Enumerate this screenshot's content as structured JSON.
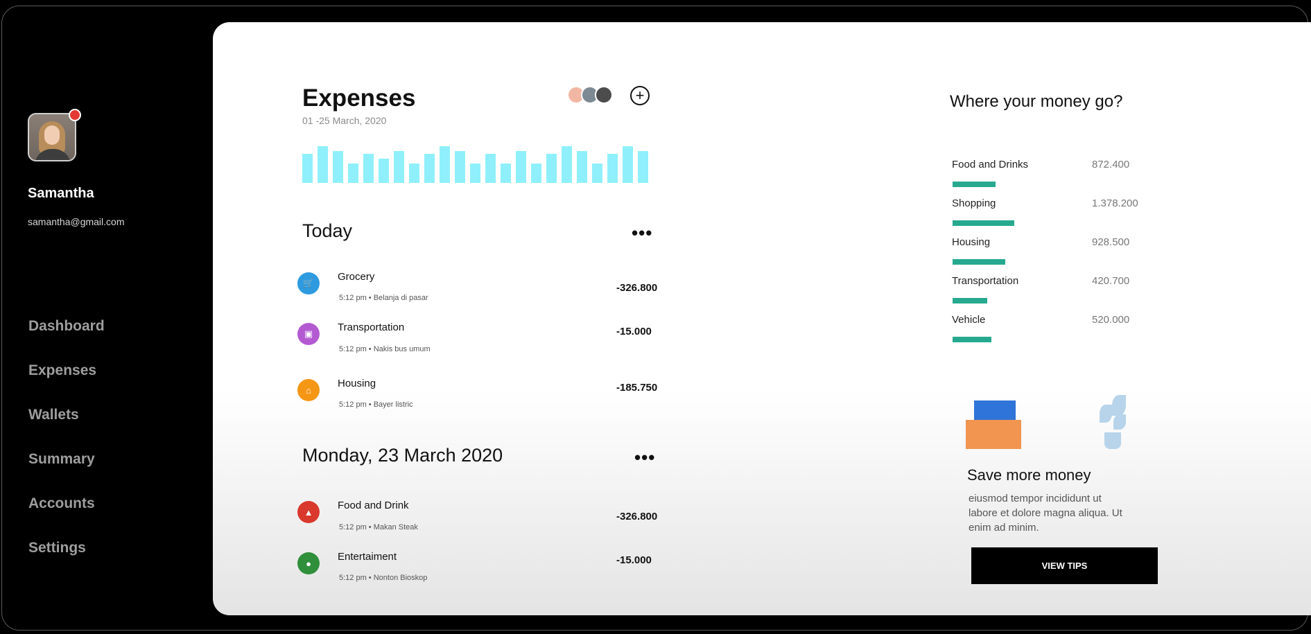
{
  "user": {
    "name": "Samantha",
    "email": "samantha@gmail.com"
  },
  "nav": {
    "items": [
      {
        "label": "Dashboard"
      },
      {
        "label": "Expenses"
      },
      {
        "label": "Wallets"
      },
      {
        "label": "Summary"
      },
      {
        "label": "Accounts"
      },
      {
        "label": "Settings"
      }
    ]
  },
  "expenses": {
    "title": "Expenses",
    "date_range": "01 -25 March, 2020",
    "add_icon": "plus-circle-icon",
    "more_icon": "•••",
    "chart_data": {
      "type": "bar",
      "values": [
        36,
        46,
        40,
        24,
        36,
        30,
        40,
        24,
        36,
        46,
        40,
        24,
        36,
        24,
        40,
        24,
        36,
        46,
        40,
        24,
        36,
        46,
        40
      ]
    }
  },
  "groups": [
    {
      "title": "Today",
      "items": [
        {
          "name": "Grocery",
          "meta": "5:12 pm • Belanja di pasar",
          "amount": "-326.800",
          "color": "#2e9ae0",
          "icon": "cart-icon",
          "glyph": "🛒"
        },
        {
          "name": "Transportation",
          "meta": "5:12 pm • Nakis bus umum",
          "amount": "-15.000",
          "color": "#b35ad2",
          "icon": "bus-icon",
          "glyph": "▣"
        },
        {
          "name": "Housing",
          "meta": "5:12 pm • Bayer listric",
          "amount": "-185.750",
          "color": "#f59615",
          "icon": "home-icon",
          "glyph": "⌂"
        }
      ]
    },
    {
      "title": "Monday, 23 March 2020",
      "items": [
        {
          "name": "Food and Drink",
          "meta": "5:12 pm • Makan Steak",
          "amount": "-326.800",
          "color": "#d9382c",
          "icon": "food-icon",
          "glyph": "▲"
        },
        {
          "name": "Entertaiment",
          "meta": "5:12 pm • Nonton Bioskop",
          "amount": "-15.000",
          "color": "#2f8f3a",
          "icon": "play-icon",
          "glyph": "●"
        }
      ]
    }
  ],
  "money": {
    "title": "Where your money go?",
    "chart_data": {
      "type": "bar",
      "categories": [
        "Food and Drinks",
        "Shopping",
        "Housing",
        "Transportation",
        "Vehicle"
      ],
      "values": [
        "872.400",
        "1.378.200",
        "928.500",
        "420.700",
        "520.000"
      ],
      "fill_fraction": [
        0.63,
        0.91,
        0.78,
        0.51,
        0.57
      ],
      "color": "#26a98f"
    }
  },
  "tips": {
    "title": "Save more money",
    "body": "eiusmod tempor incididunt ut labore et dolore magna aliqua. Ut enim ad minim.",
    "button": "VIEW TIPS"
  }
}
